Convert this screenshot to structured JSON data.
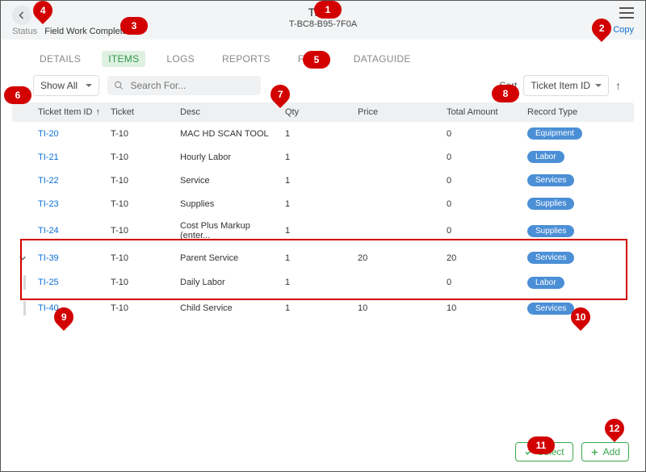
{
  "header": {
    "title": "Ticket",
    "subtitle": "T-BC8-B95-7F0A",
    "copy_label": "Copy",
    "status_label": "Status",
    "status_value": "Field Work Complete"
  },
  "tabs": {
    "details": "DETAILS",
    "items": "ITEMS",
    "logs": "LOGS",
    "reports": "REPORTS",
    "files": "FILES",
    "dataguide": "DATAGUIDE"
  },
  "filters": {
    "show_all": "Show All",
    "search_placeholder": "Search For...",
    "sort_label": "Sort",
    "sort_field": "Ticket Item ID"
  },
  "columns": {
    "id": "Ticket Item ID",
    "ticket": "Ticket",
    "desc": "Desc",
    "qty": "Qty",
    "price": "Price",
    "total": "Total Amount",
    "type": "Record Type"
  },
  "rows": [
    {
      "id": "TI-20",
      "ticket": "T-10",
      "desc": "MAC HD SCAN TOOL",
      "qty": "1",
      "price": "",
      "total": "0",
      "type": "Equipment",
      "expand": "",
      "child": false
    },
    {
      "id": "TI-21",
      "ticket": "T-10",
      "desc": "Hourly Labor",
      "qty": "1",
      "price": "",
      "total": "0",
      "type": "Labor",
      "expand": "",
      "child": false
    },
    {
      "id": "TI-22",
      "ticket": "T-10",
      "desc": "Service",
      "qty": "1",
      "price": "",
      "total": "0",
      "type": "Services",
      "expand": "",
      "child": false
    },
    {
      "id": "TI-23",
      "ticket": "T-10",
      "desc": "Supplies",
      "qty": "1",
      "price": "",
      "total": "0",
      "type": "Supplies",
      "expand": "",
      "child": false
    },
    {
      "id": "TI-24",
      "ticket": "T-10",
      "desc": "Cost Plus Markup (enter...",
      "qty": "1",
      "price": "",
      "total": "0",
      "type": "Supplies",
      "expand": "",
      "child": false
    },
    {
      "id": "TI-39",
      "ticket": "T-10",
      "desc": "Parent Service",
      "qty": "1",
      "price": "20",
      "total": "20",
      "type": "Services",
      "expand": "v",
      "child": false
    },
    {
      "id": "TI-25",
      "ticket": "T-10",
      "desc": "Daily Labor",
      "qty": "1",
      "price": "",
      "total": "0",
      "type": "Labor",
      "expand": "",
      "child": true
    },
    {
      "id": "TI-40",
      "ticket": "T-10",
      "desc": "Child Service",
      "qty": "1",
      "price": "10",
      "total": "10",
      "type": "Services",
      "expand": "",
      "child": true
    }
  ],
  "footer": {
    "select": "Select",
    "add": "Add"
  },
  "callouts": {
    "c1": "1",
    "c2": "2",
    "c3": "3",
    "c4": "4",
    "c5": "5",
    "c6": "6",
    "c7": "7",
    "c8": "8",
    "c9": "9",
    "c10": "10",
    "c11": "11",
    "c12": "12"
  }
}
